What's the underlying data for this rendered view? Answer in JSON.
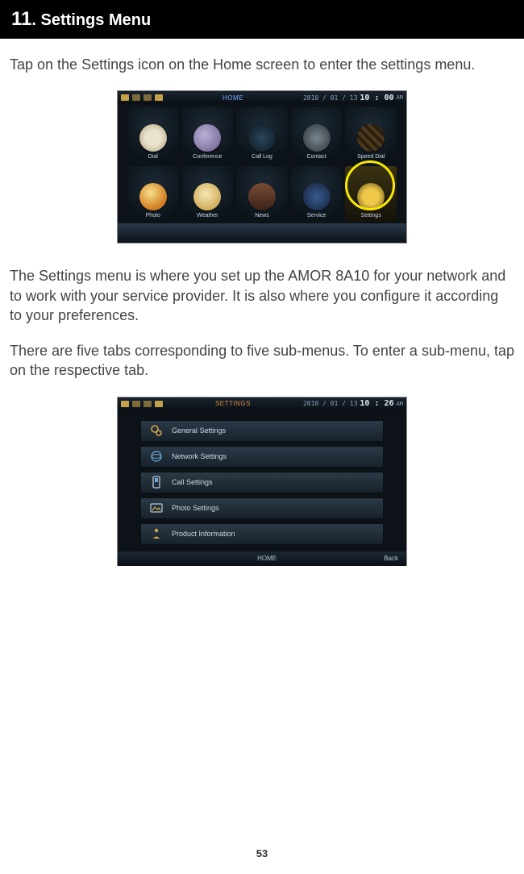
{
  "header": {
    "chapter_num": "11",
    "title": ". Settings Menu"
  },
  "p1": "Tap on the Settings icon on the Home screen to enter the settings menu.",
  "p2": "The Settings menu is where you set up the AMOR 8A10 for your network and to work with your service provider. It is also where you configure it according to your preferences.",
  "p3": "There are five tabs corresponding to five sub-menus. To enter a sub-menu, tap on the respective tab.",
  "home": {
    "title": "HOME",
    "date": "2010 / 01 / 13",
    "time": "10 : 00",
    "ampm": "AM",
    "apps": [
      {
        "label": "Dial"
      },
      {
        "label": "Conference"
      },
      {
        "label": "Call Log"
      },
      {
        "label": "Contact"
      },
      {
        "label": "Speed Dial"
      },
      {
        "label": "Photo"
      },
      {
        "label": "Weather"
      },
      {
        "label": "News"
      },
      {
        "label": "Service"
      },
      {
        "label": "Settings"
      }
    ]
  },
  "settings": {
    "title": "SETTINGS",
    "date": "2010 / 01 / 13",
    "time": "10 : 26",
    "ampm": "AM",
    "rows": [
      {
        "label": "General Settings"
      },
      {
        "label": "Network Settings"
      },
      {
        "label": "Call Settings"
      },
      {
        "label": "Photo Settings"
      },
      {
        "label": "Product Information"
      }
    ],
    "home_btn": "HOME",
    "back_btn": "Back"
  },
  "page_number": "53"
}
